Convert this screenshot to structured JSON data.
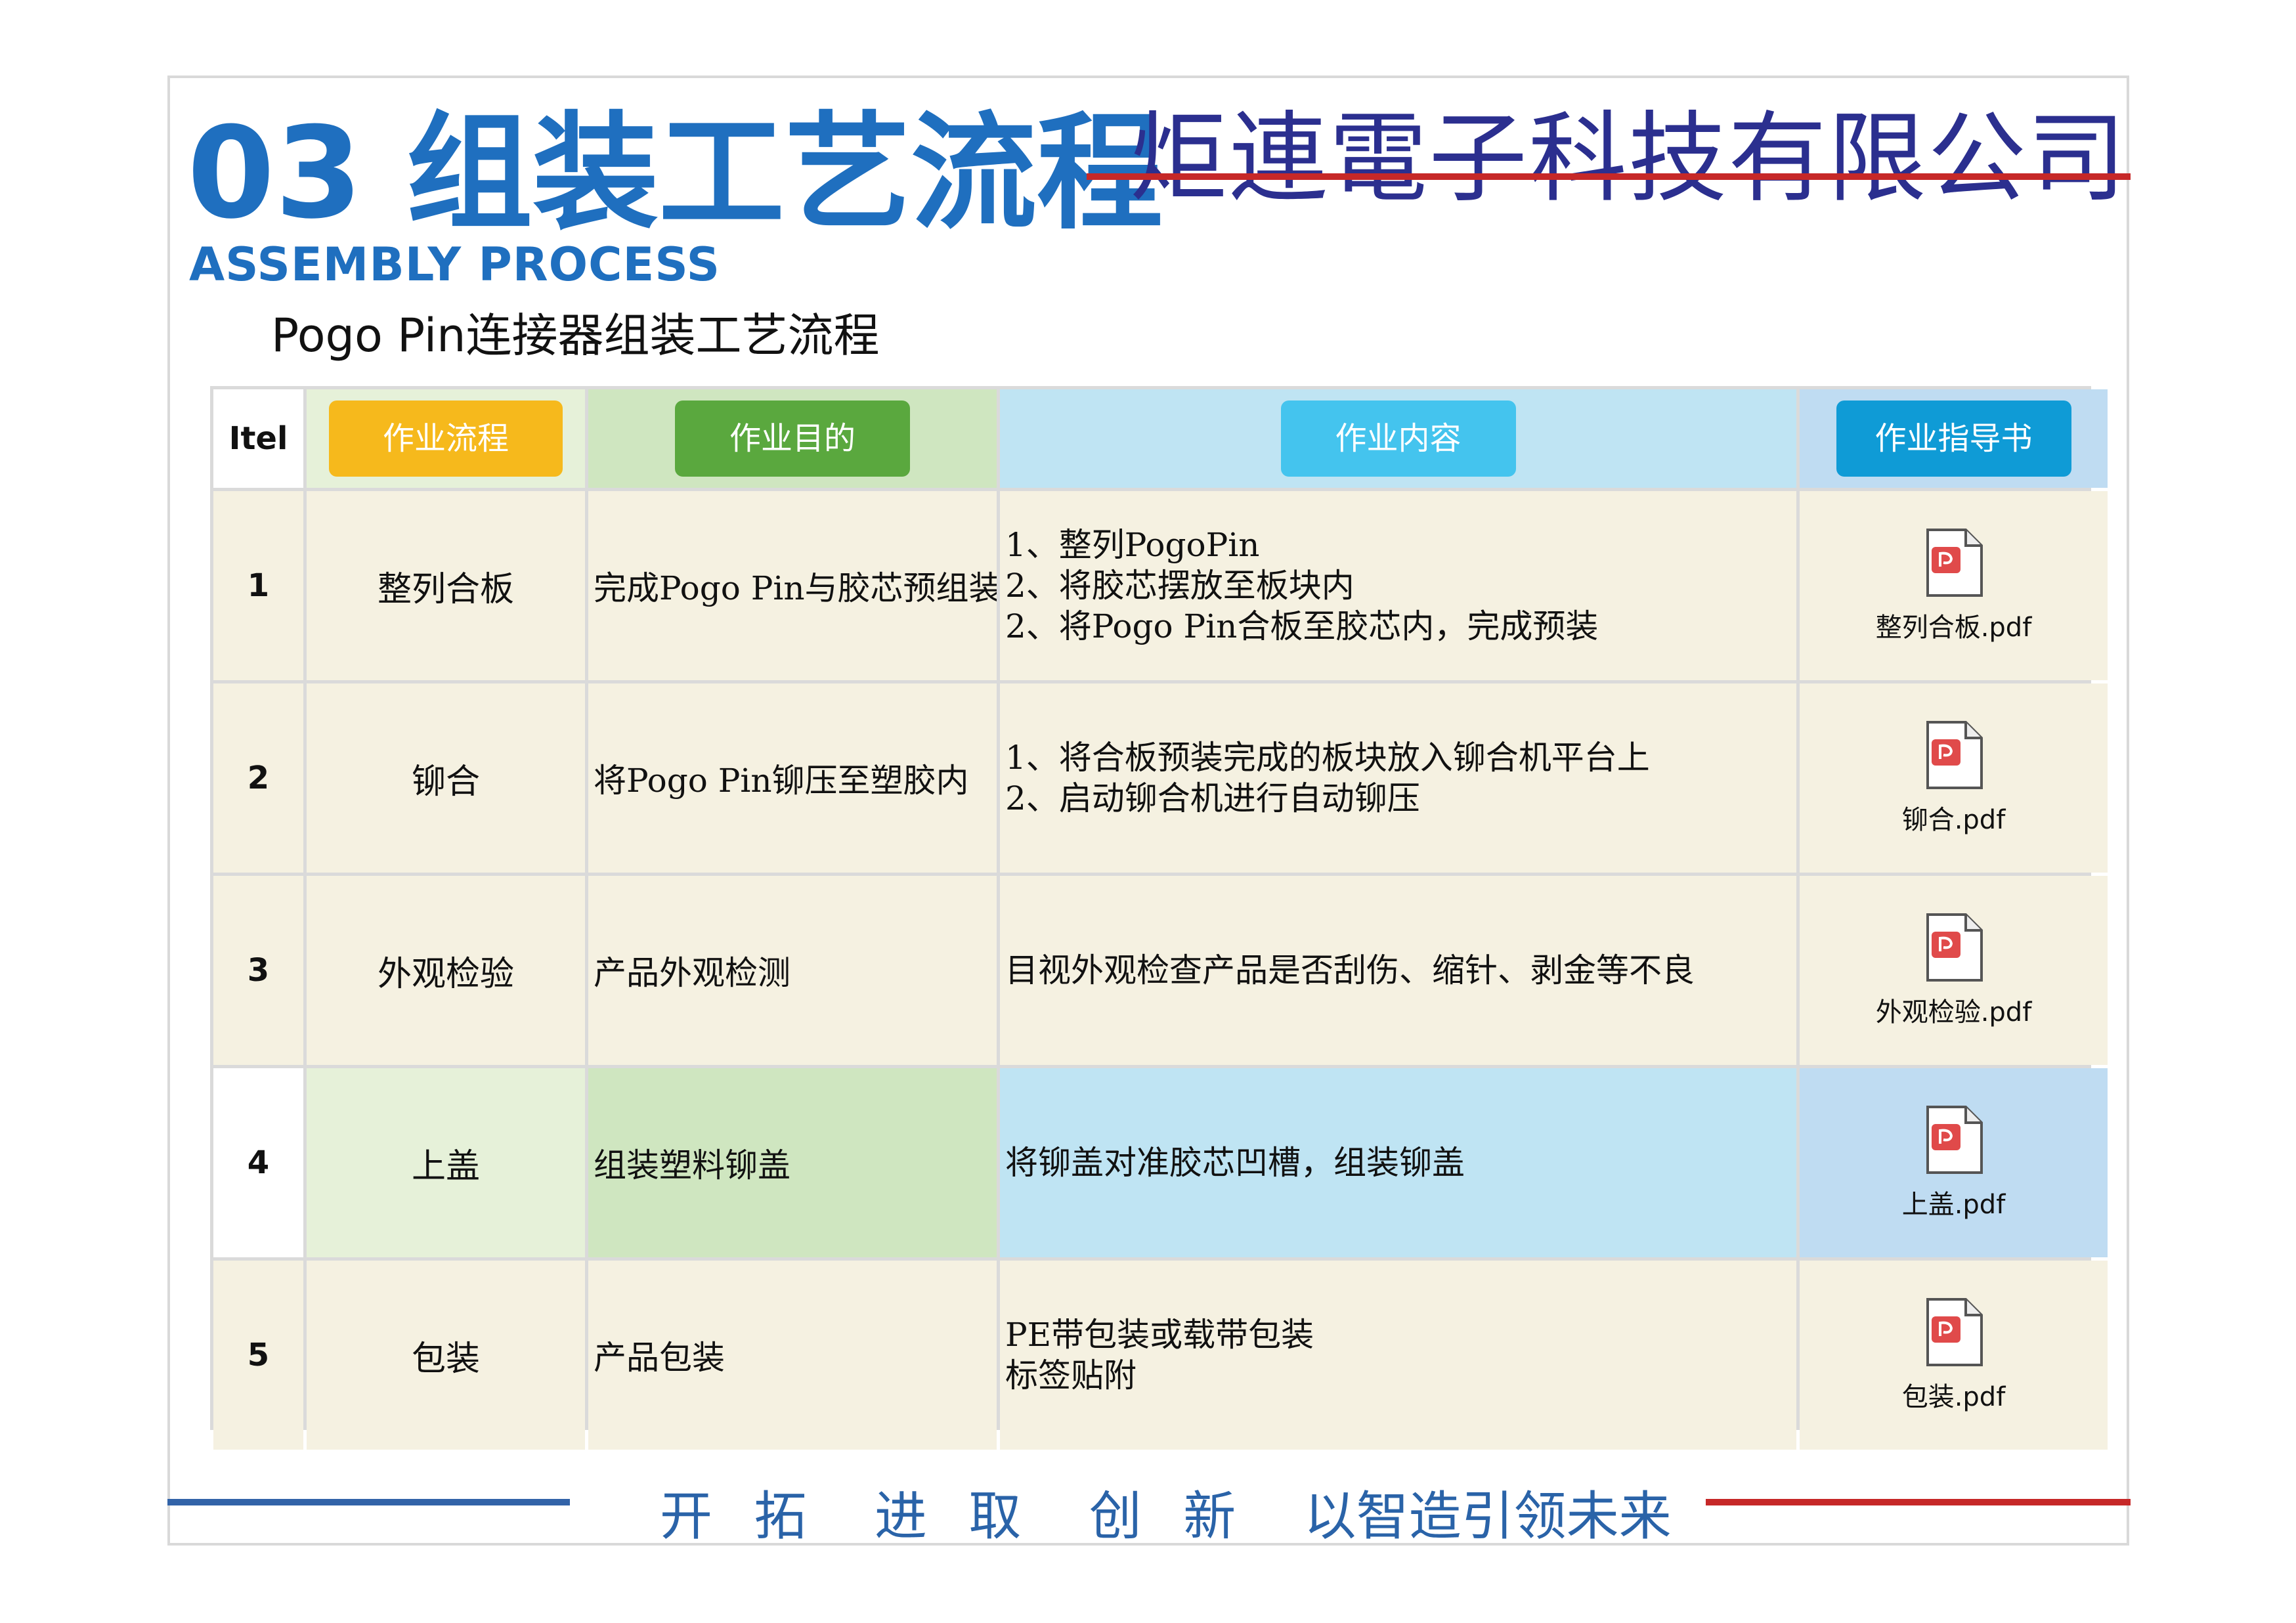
{
  "header": {
    "title": "03 组装工艺流程",
    "subtitle": "ASSEMBLY PROCESS",
    "description": "Pogo Pin连接器组装工艺流程",
    "company": "炬連電子科技有限公司"
  },
  "table": {
    "headers": {
      "item": "Itel",
      "process": "作业流程",
      "purpose": "作业目的",
      "content": "作业内容",
      "guide": "作业指导书"
    },
    "rows": [
      {
        "num": "1",
        "process": "整列合板",
        "purpose": "完成Pogo Pin与胶芯预组装",
        "content": [
          "1、整列PogoPin",
          "2、将胶芯摆放至板块内",
          "2、将Pogo Pin合板至胶芯内，完成预装"
        ],
        "guide": "整列合板.pdf"
      },
      {
        "num": "2",
        "process": "铆合",
        "purpose": "将Pogo Pin铆压至塑胶内",
        "content": [
          "1、将合板预装完成的板块放入铆合机平台上",
          "2、启动铆合机进行自动铆压"
        ],
        "guide": "铆合.pdf"
      },
      {
        "num": "3",
        "process": "外观检验",
        "purpose": "产品外观检测",
        "content": [
          "目视外观检查产品是否刮伤、缩针、剥金等不良"
        ],
        "guide": "外观检验.pdf"
      },
      {
        "num": "4",
        "process": "上盖",
        "purpose": "组装塑料铆盖",
        "content": [
          "将铆盖对准胶芯凹槽，组装铆盖"
        ],
        "guide": "上盖.pdf"
      },
      {
        "num": "5",
        "process": "包装",
        "purpose": "产品包装",
        "content": [
          "PE带包装或载带包装",
          "标签贴附"
        ],
        "guide": "包装.pdf"
      }
    ]
  },
  "footer": {
    "slogan": [
      "开",
      "拓",
      "进",
      "取",
      "创",
      "新",
      "以智造引领未来"
    ]
  },
  "colors": {
    "title_blue": "#1f6fbf",
    "company_navy": "#2b2f8f",
    "accent_red": "#c62828",
    "row_beige": "#f5f1e1",
    "pdf_red": "#e04a4a"
  },
  "icons": {
    "guide_file": "pdf-file-icon"
  }
}
